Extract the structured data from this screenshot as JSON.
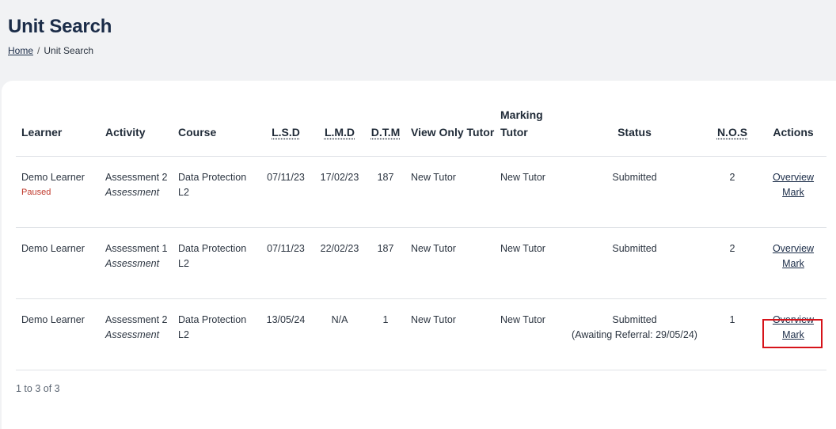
{
  "page": {
    "title": "Unit Search",
    "breadcrumb": {
      "home": "Home",
      "separator": "/",
      "current": "Unit Search"
    }
  },
  "table": {
    "headers": {
      "learner": "Learner",
      "activity": "Activity",
      "course": "Course",
      "lsd": "L.S.D",
      "lmd": "L.M.D",
      "dtm": "D.T.M",
      "view_only_tutor": "View Only Tutor",
      "marking_tutor": "Marking Tutor",
      "status": "Status",
      "nos": "N.O.S",
      "actions": "Actions"
    },
    "rows": [
      {
        "learner": "Demo Learner",
        "learner_flag": "Paused",
        "activity": "Assessment 2",
        "activity_type": "Assessment",
        "course": "Data Protection L2",
        "lsd": "07/11/23",
        "lmd": "17/02/23",
        "dtm": "187",
        "view_only_tutor": "New Tutor",
        "marking_tutor": "New Tutor",
        "status": "Submitted",
        "status_detail": "",
        "nos": "2",
        "overview": "Overview",
        "mark": "Mark"
      },
      {
        "learner": "Demo Learner",
        "learner_flag": "",
        "activity": "Assessment 1",
        "activity_type": "Assessment",
        "course": "Data Protection L2",
        "lsd": "07/11/23",
        "lmd": "22/02/23",
        "dtm": "187",
        "view_only_tutor": "New Tutor",
        "marking_tutor": "New Tutor",
        "status": "Submitted",
        "status_detail": "",
        "nos": "2",
        "overview": "Overview",
        "mark": "Mark"
      },
      {
        "learner": "Demo Learner",
        "learner_flag": "",
        "activity": "Assessment 2",
        "activity_type": "Assessment",
        "course": "Data Protection L2",
        "lsd": "13/05/24",
        "lmd": "N/A",
        "dtm": "1",
        "view_only_tutor": "New Tutor",
        "marking_tutor": "New Tutor",
        "status": "Submitted",
        "status_detail": "(Awaiting Referral: 29/05/24)",
        "nos": "1",
        "overview": "Overview",
        "mark": "Mark"
      }
    ]
  },
  "pagination": {
    "summary": "1 to 3 of 3"
  },
  "colors": {
    "background": "#f1f2f4",
    "title": "#1b2c48",
    "paused": "#c0392b",
    "highlight": "#d6131a"
  }
}
